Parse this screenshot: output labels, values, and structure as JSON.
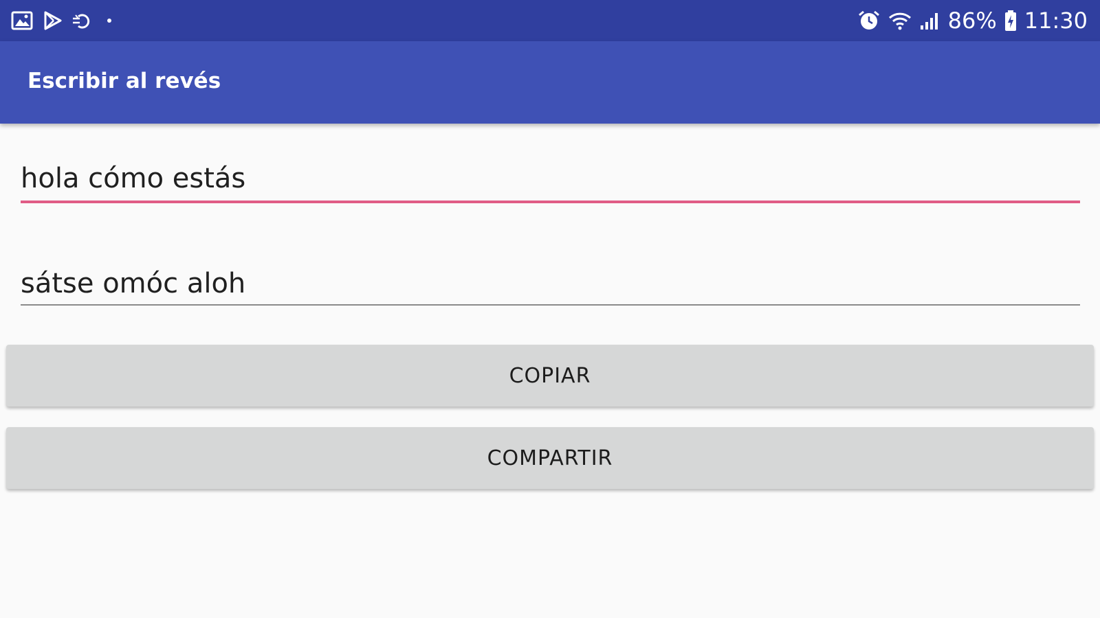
{
  "status_bar": {
    "left_icons": [
      "gallery-icon",
      "play-store-icon",
      "sync-icon",
      "dot-icon"
    ],
    "right_icons": [
      "alarm-icon",
      "wifi-icon",
      "signal-icon",
      "battery-icon"
    ],
    "battery": "86%",
    "time": "11:30",
    "color": "#303f9f"
  },
  "app_bar": {
    "title": "Escribir al revés",
    "color": "#3f51b5"
  },
  "input_field": {
    "value": "hola cómo estás",
    "accent_color": "#e05c86"
  },
  "output_field": {
    "value": "sátse omóc aloh"
  },
  "buttons": {
    "copy_label": "COPIAR",
    "share_label": "COMPARTIR"
  }
}
